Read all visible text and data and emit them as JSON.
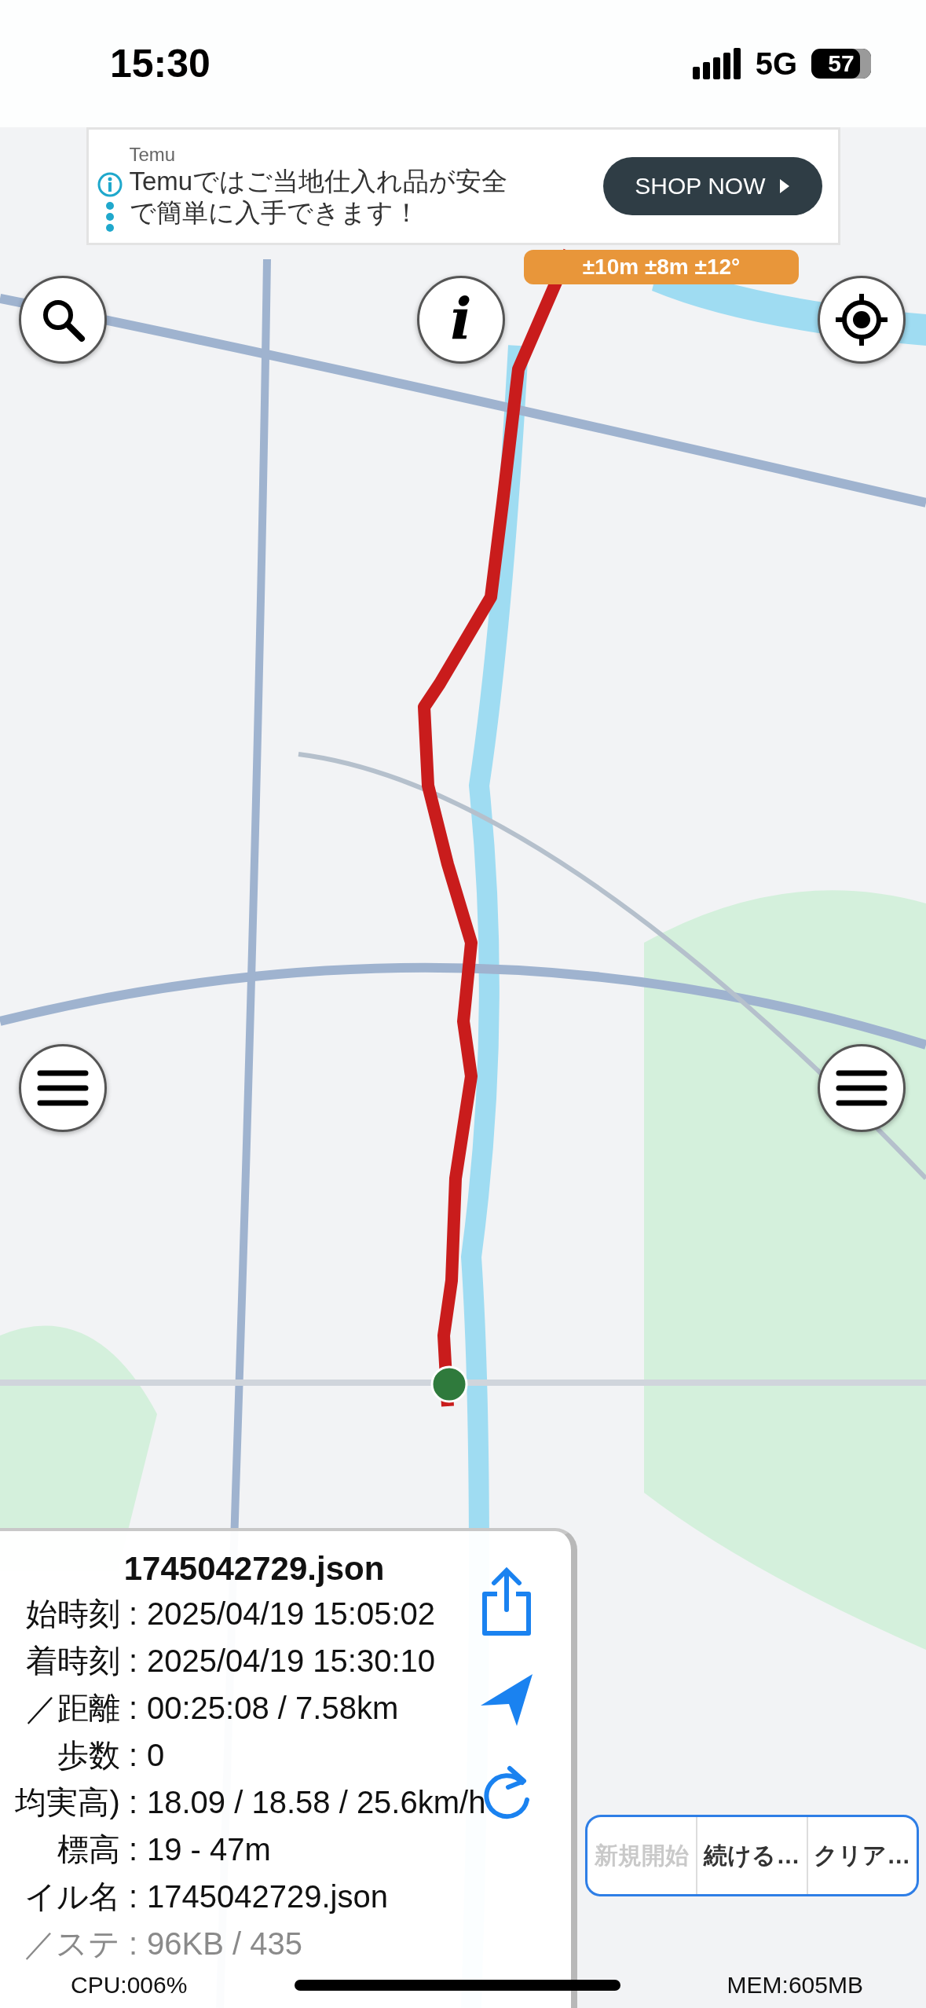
{
  "status_bar": {
    "time": "15:30",
    "network": "5G",
    "battery": "57"
  },
  "ad": {
    "advertiser": "Temu",
    "text": "Temuではご当地仕入れ品が安全で簡単に入手できます！",
    "button": "SHOP NOW"
  },
  "accuracy_badge": "±10m ±8m ±12°",
  "info_button": "i",
  "track_panel": {
    "title": "1745042729.json",
    "rows": [
      {
        "label": "始時刻 :",
        "value": "2025/04/19 15:05:02",
        "dimmed": false
      },
      {
        "label": "着時刻 :",
        "value": "2025/04/19 15:30:10",
        "dimmed": false
      },
      {
        "label": "／距離 :",
        "value": "00:25:08 / 7.58km",
        "dimmed": false
      },
      {
        "label": "歩数 :",
        "value": "0",
        "dimmed": false
      },
      {
        "label": "均実高) :",
        "value": "18.09 / 18.58 / 25.6km/h",
        "dimmed": false
      },
      {
        "label": "標高 :",
        "value": "19 - 47m",
        "dimmed": false
      },
      {
        "label": "イル名 :",
        "value": "1745042729.json",
        "dimmed": false
      },
      {
        "label": "／ステ :",
        "value": "96KB / 435",
        "dimmed": true
      }
    ]
  },
  "actions": [
    {
      "label": "新規開始",
      "disabled": true
    },
    {
      "label": "続ける…",
      "disabled": false
    },
    {
      "label": "クリア…",
      "disabled": false
    }
  ],
  "footer": {
    "cpu": "CPU:006%",
    "mem": "MEM:605MB"
  }
}
